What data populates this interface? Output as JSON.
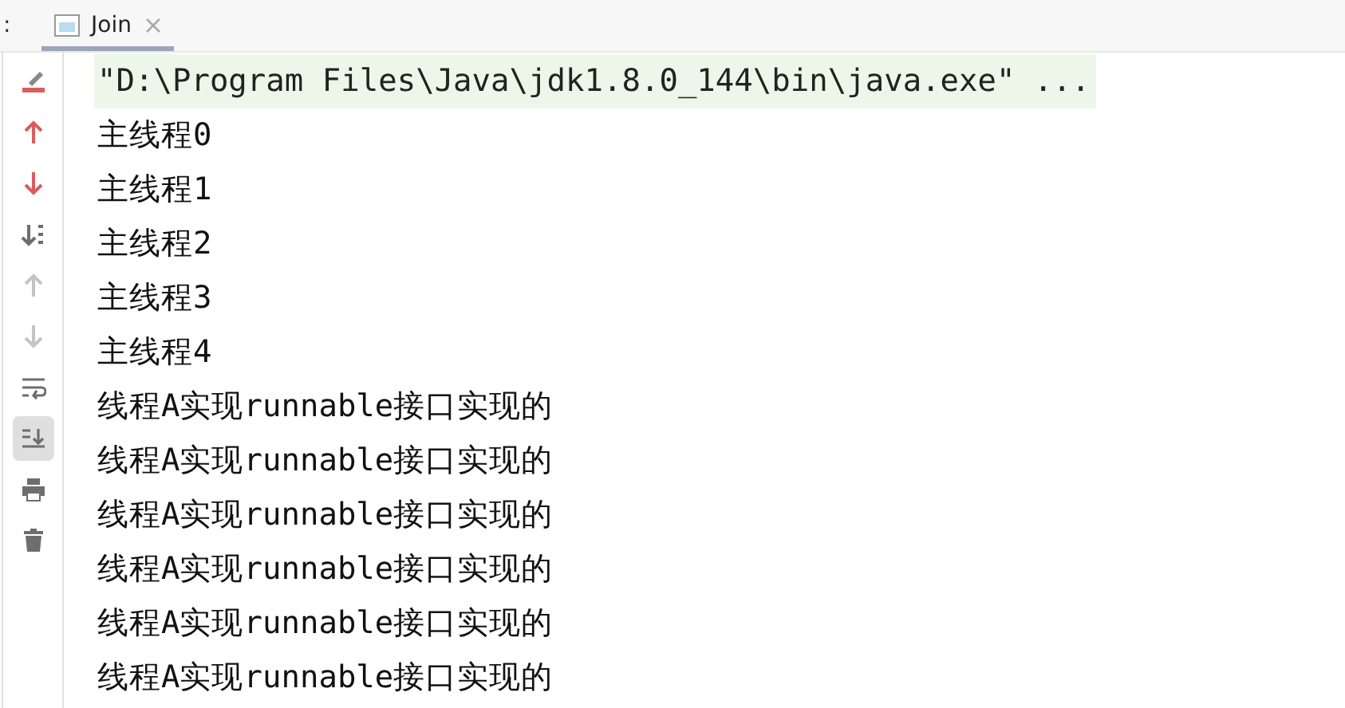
{
  "header": {
    "label": ":",
    "tabs": [
      {
        "title": "Join",
        "selected": true
      }
    ]
  },
  "toolbar": [
    {
      "kind": "clear",
      "disabled": false,
      "selected": false
    },
    {
      "kind": "up",
      "disabled": false,
      "selected": false
    },
    {
      "kind": "down",
      "disabled": false,
      "selected": false
    },
    {
      "kind": "sort",
      "disabled": false,
      "selected": false
    },
    {
      "kind": "up",
      "disabled": true,
      "selected": false
    },
    {
      "kind": "down",
      "disabled": true,
      "selected": false
    },
    {
      "kind": "wrap",
      "disabled": false,
      "selected": false
    },
    {
      "kind": "scroll",
      "disabled": false,
      "selected": true
    },
    {
      "kind": "print",
      "disabled": false,
      "selected": false
    },
    {
      "kind": "trash",
      "disabled": false,
      "selected": false
    }
  ],
  "console": [
    {
      "text": "\"D:\\Program Files\\Java\\jdk1.8.0_144\\bin\\java.exe\" ...",
      "kind": "command"
    },
    {
      "text": "主线程0",
      "kind": "output"
    },
    {
      "text": "主线程1",
      "kind": "output"
    },
    {
      "text": "主线程2",
      "kind": "output"
    },
    {
      "text": "主线程3",
      "kind": "output"
    },
    {
      "text": "主线程4",
      "kind": "output"
    },
    {
      "text": "线程A实现runnable接口实现的",
      "kind": "output"
    },
    {
      "text": "线程A实现runnable接口实现的",
      "kind": "output"
    },
    {
      "text": "线程A实现runnable接口实现的",
      "kind": "output"
    },
    {
      "text": "线程A实现runnable接口实现的",
      "kind": "output"
    },
    {
      "text": "线程A实现runnable接口实现的",
      "kind": "output"
    },
    {
      "text": "线程A实现runnable接口实现的",
      "kind": "output"
    }
  ]
}
